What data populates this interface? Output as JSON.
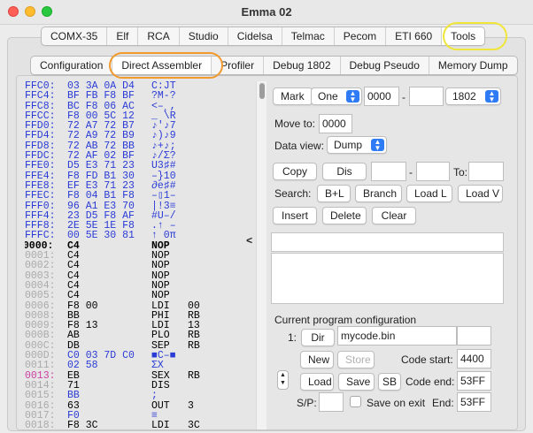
{
  "window": {
    "title": "Emma 02"
  },
  "top_tabs": [
    "COMX-35",
    "Elf",
    "RCA",
    "Studio",
    "Cidelsa",
    "Telmac",
    "Pecom",
    "ETI 660",
    "Tools"
  ],
  "top_tab_active": "Tools",
  "sub_tabs": [
    "Configuration",
    "Direct Assembler",
    "Profiler",
    "Debug 1802",
    "Debug Pseudo",
    "Memory Dump"
  ],
  "sub_tab_active": "Direct Assembler",
  "code_rows": [
    {
      "addr": "FFC0:",
      "bytes": "03 3A 0A D4",
      "asm": "C:JT",
      "args": "",
      "style": "hex"
    },
    {
      "addr": "FFC4:",
      "bytes": "BF FB F8 BF",
      "asm": "?M-?",
      "args": "",
      "style": "hex"
    },
    {
      "addr": "FFC8:",
      "bytes": "BC F8 06 AC",
      "asm": "<–¸,",
      "args": "",
      "style": "hex"
    },
    {
      "addr": "FFCC:",
      "bytes": "F8 00 5C 12",
      "asm": "_ \\R",
      "args": "",
      "style": "hex"
    },
    {
      "addr": "FFD0:",
      "bytes": "72 A7 72 B7",
      "asm": "♪'♪7",
      "args": "",
      "style": "hex"
    },
    {
      "addr": "FFD4:",
      "bytes": "72 A9 72 B9",
      "asm": "♪)♪9",
      "args": "",
      "style": "hex"
    },
    {
      "addr": "FFD8:",
      "bytes": "72 AB 72 BB",
      "asm": "♪+♪;",
      "args": "",
      "style": "hex"
    },
    {
      "addr": "FFDC:",
      "bytes": "72 AF 02 BF",
      "asm": "♪/Σ?",
      "args": "",
      "style": "hex"
    },
    {
      "addr": "FFE0:",
      "bytes": "D5 E3 71 23",
      "asm": "U3♯#",
      "args": "",
      "style": "hex"
    },
    {
      "addr": "FFE4:",
      "bytes": "F8 FD B1 30",
      "asm": "–}10",
      "args": "",
      "style": "hex"
    },
    {
      "addr": "FFE8:",
      "bytes": "EF E3 71 23",
      "asm": "∂e♯#",
      "args": "",
      "style": "hex"
    },
    {
      "addr": "FFEC:",
      "bytes": "F8 04 B1 F8",
      "asm": "–▯1–",
      "args": "",
      "style": "hex"
    },
    {
      "addr": "FFF0:",
      "bytes": "96 A1 E3 70",
      "asm": "|!3≡",
      "args": "",
      "style": "hex"
    },
    {
      "addr": "FFF4:",
      "bytes": "23 D5 F8 AF",
      "asm": "#U–/",
      "args": "",
      "style": "hex"
    },
    {
      "addr": "FFF8:",
      "bytes": "2E 5E 1E F8",
      "asm": ".↑ –",
      "args": "",
      "style": "hex"
    },
    {
      "addr": "FFFC:",
      "bytes": "00 5E 30 81",
      "asm": "↑ 0π",
      "args": "",
      "style": "hex"
    },
    {
      "addr": ">0000:",
      "bytes": "C4",
      "asm": "NOP",
      "args": "",
      "style": "cur"
    },
    {
      "addr": "0001:",
      "bytes": "C4",
      "asm": "NOP",
      "args": "",
      "style": "norm"
    },
    {
      "addr": "0002:",
      "bytes": "C4",
      "asm": "NOP",
      "args": "",
      "style": "norm"
    },
    {
      "addr": "0003:",
      "bytes": "C4",
      "asm": "NOP",
      "args": "",
      "style": "norm"
    },
    {
      "addr": "0004:",
      "bytes": "C4",
      "asm": "NOP",
      "args": "",
      "style": "norm"
    },
    {
      "addr": "0005:",
      "bytes": "C4",
      "asm": "NOP",
      "args": "",
      "style": "norm"
    },
    {
      "addr": "0006:",
      "bytes": "F8 00",
      "asm": "LDI",
      "args": "00",
      "style": "norm"
    },
    {
      "addr": "0008:",
      "bytes": "BB",
      "asm": "PHI",
      "args": "RB",
      "style": "norm"
    },
    {
      "addr": "0009:",
      "bytes": "F8 13",
      "asm": "LDI",
      "args": "13",
      "style": "norm"
    },
    {
      "addr": "000B:",
      "bytes": "AB",
      "asm": "PLO",
      "args": "RB",
      "style": "norm"
    },
    {
      "addr": "000C:",
      "bytes": "DB",
      "asm": "SEP",
      "args": "RB",
      "style": "norm"
    },
    {
      "addr": "000D:",
      "bytes": "C0 03 7D C0",
      "asm": "■C–■",
      "args": "",
      "style": "hexdata"
    },
    {
      "addr": "0011:",
      "bytes": "02 58",
      "asm": "ΣX",
      "args": "",
      "style": "hexdata"
    },
    {
      "addr": "0013:",
      "bytes": "EB",
      "asm": "SEX",
      "args": "RB",
      "style": "mag"
    },
    {
      "addr": "0014:",
      "bytes": "71",
      "asm": "DIS",
      "args": "",
      "style": "norm"
    },
    {
      "addr": "0015:",
      "bytes": "BB",
      "asm": ";",
      "args": "",
      "style": "hexdata"
    },
    {
      "addr": "0016:",
      "bytes": "63",
      "asm": "OUT",
      "args": "3",
      "style": "norm"
    },
    {
      "addr": "0017:",
      "bytes": "F0",
      "asm": "≡",
      "args": "",
      "style": "hexdata"
    },
    {
      "addr": "0018:",
      "bytes": "F8 3C",
      "asm": "LDI",
      "args": "3C",
      "style": "norm"
    }
  ],
  "cursor_marker": "<",
  "controls": {
    "mark_label": "Mark",
    "mark_select": "One",
    "mark_start": "0000",
    "dash": "-",
    "mark_end": "",
    "cpu_select": "1802",
    "move_to_label": "Move to:",
    "move_to_value": "0000",
    "data_view_label": "Data view:",
    "data_view_select": "Dump",
    "copy_label": "Copy",
    "dis_label": "Dis",
    "copy_from": "",
    "copy_to_end": "",
    "to_label": "To:",
    "copy_dest": "",
    "search_label": "Search:",
    "search_bl": "B+L",
    "search_branch": "Branch",
    "search_loadl": "Load L",
    "search_loadv": "Load V",
    "insert_label": "Insert",
    "delete_label": "Delete",
    "clear_label": "Clear",
    "input_line": "",
    "output_text": ""
  },
  "program_config": {
    "heading": "Current program configuration",
    "slot_label": "1:",
    "dir_label": "Dir",
    "filename": "mycode.bin",
    "extra": "",
    "new_label": "New",
    "store_label": "Store",
    "code_start_label": "Code start:",
    "code_start_value": "4400",
    "load_label": "Load",
    "save_label": "Save",
    "sb_label": "SB",
    "code_end_label": "Code end:",
    "code_end_value": "53FF",
    "sp_label": "S/P:",
    "sp_value": "",
    "save_on_exit_label": "Save on exit",
    "end_label": "End:",
    "end_value": "53FF"
  },
  "colors": {
    "hex_blue": "#2a3bd6",
    "highlight_yellow": "#f0e63a",
    "highlight_orange": "#f29a2e",
    "select_blue": "#2f7bf6"
  }
}
